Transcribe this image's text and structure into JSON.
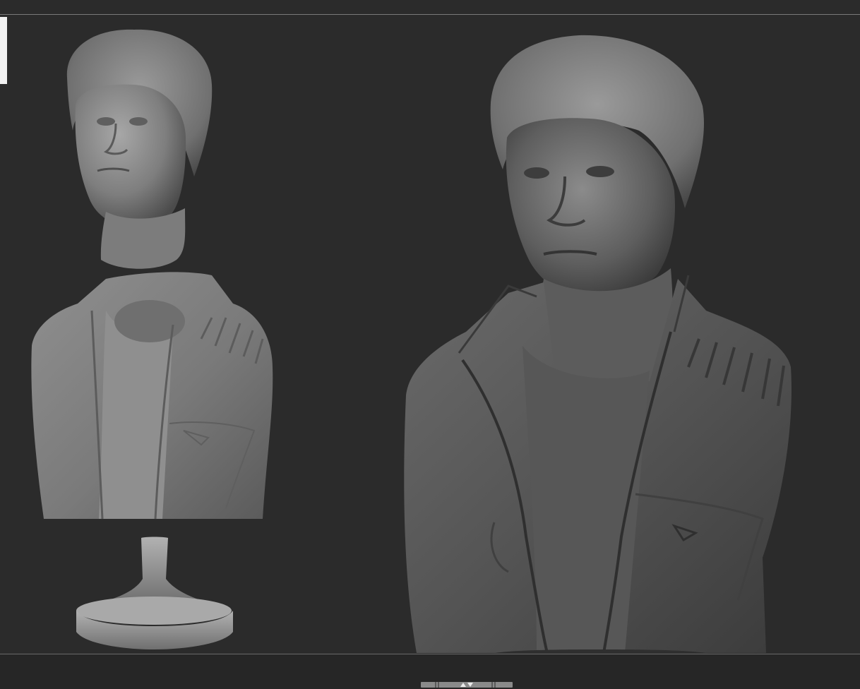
{
  "app": {
    "name": ""
  },
  "viewport": {
    "models": [
      {
        "name": "exploded-bust-parts",
        "parts": [
          "head",
          "torso",
          "base"
        ]
      },
      {
        "name": "assembled-bust"
      }
    ]
  },
  "scrollbar": {
    "icon": "scroll-arrows-icon"
  },
  "colors": {
    "background": "#2b2b2b",
    "clay": "#8c8c8c",
    "line": "#7a7a7a"
  }
}
